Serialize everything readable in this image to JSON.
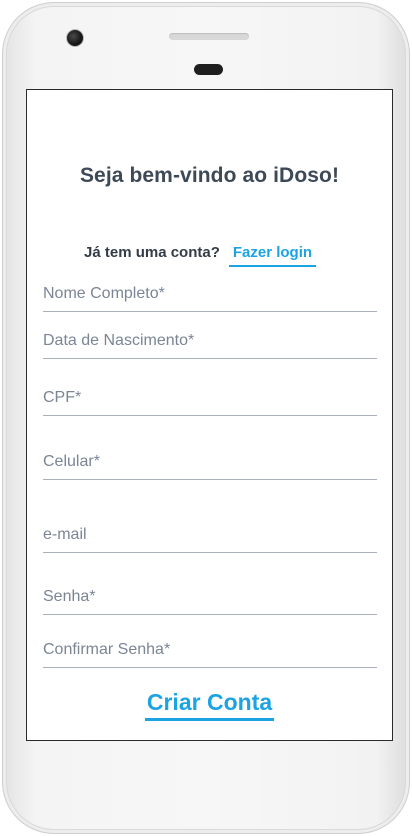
{
  "header": {
    "title": "Seja bem-vindo ao iDoso!"
  },
  "login": {
    "question": "Já tem uma conta?",
    "link_label": "Fazer login"
  },
  "form": {
    "fields": [
      {
        "placeholder": "Nome Completo*",
        "value": ""
      },
      {
        "placeholder": "Data de Nascimento*",
        "value": ""
      },
      {
        "placeholder": "CPF*",
        "value": ""
      },
      {
        "placeholder": "Celular*",
        "value": ""
      },
      {
        "placeholder": "e-mail",
        "value": ""
      },
      {
        "placeholder": "Senha*",
        "value": ""
      },
      {
        "placeholder": "Confirmar Senha*",
        "value": ""
      }
    ],
    "submit_label": "Criar Conta"
  },
  "colors": {
    "accent": "#1ba3e2",
    "title": "#3e4957",
    "field_line": "#a9afbb"
  }
}
